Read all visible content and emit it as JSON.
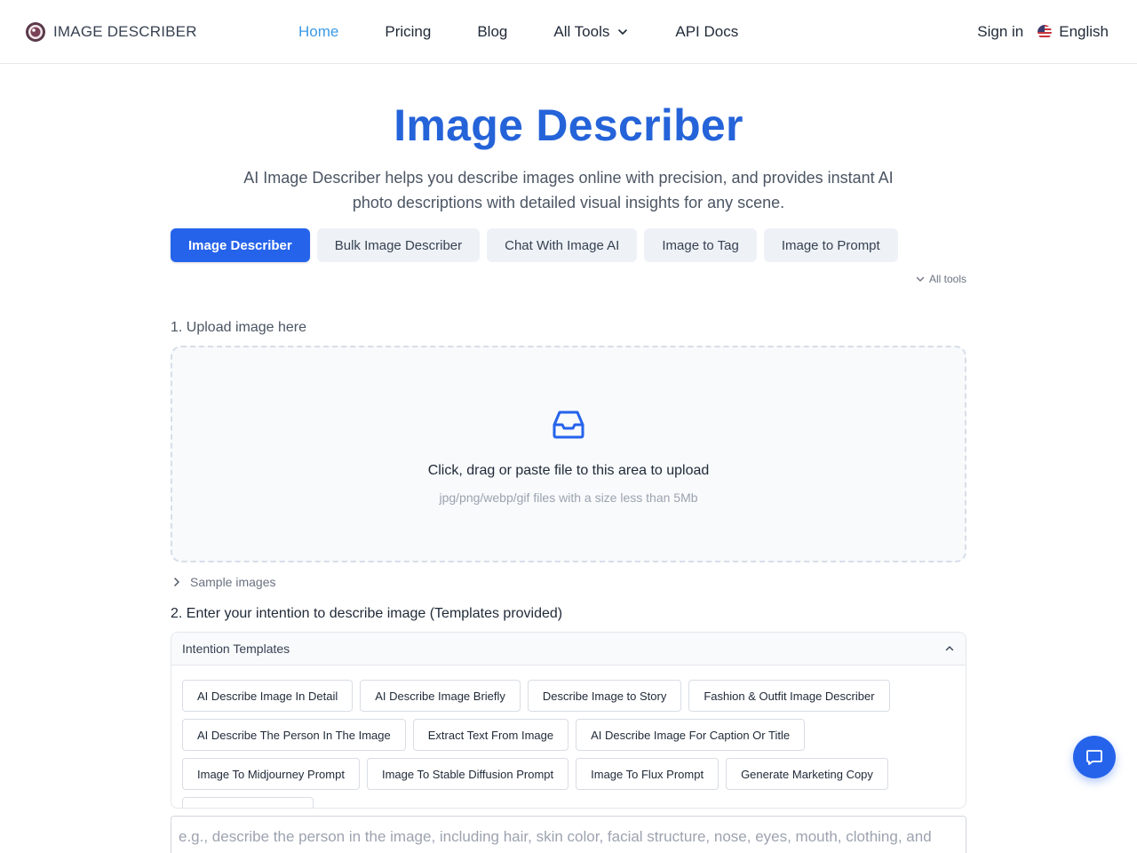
{
  "header": {
    "logo_text": "IMAGE DESCRIBER",
    "nav": {
      "home": "Home",
      "pricing": "Pricing",
      "blog": "Blog",
      "all_tools": "All Tools",
      "api_docs": "API Docs"
    },
    "sign_in": "Sign in",
    "language": "English"
  },
  "hero": {
    "title": "Image Describer",
    "subtitle": "AI Image Describer helps you describe images online with precision, and provides instant AI photo descriptions with detailed visual insights for any scene."
  },
  "tabs": [
    "Image Describer",
    "Bulk Image Describer",
    "Chat With Image AI",
    "Image to Tag",
    "Image to Prompt"
  ],
  "all_tools_link": "All tools",
  "upload": {
    "step_label": "1. Upload image here",
    "main_text": "Click, drag or paste file to this area to upload",
    "hint": "jpg/png/webp/gif files with a size less than 5Mb",
    "samples": "Sample images"
  },
  "intention": {
    "step_label": "2. Enter your intention to describe image (Templates provided)",
    "templates_title": "Intention Templates",
    "templates": [
      "AI Describe Image In Detail",
      "AI Describe Image Briefly",
      "Describe Image to Story",
      "Fashion & Outfit Image Describer",
      "AI Describe The Person In The Image",
      "Extract Text From Image",
      "AI Describe Image For Caption Or Title",
      "Image To Midjourney Prompt",
      "Image To Stable Diffusion Prompt",
      "Image To Flux Prompt",
      "Generate Marketing Copy"
    ],
    "textarea_placeholder": "e.g., describe the person in the image, including hair, skin color, facial structure, nose, eyes, mouth, clothing, and body type"
  },
  "colors": {
    "primary": "#2563eb",
    "title": "#2563d9",
    "nav_active": "#3b9ae6"
  }
}
